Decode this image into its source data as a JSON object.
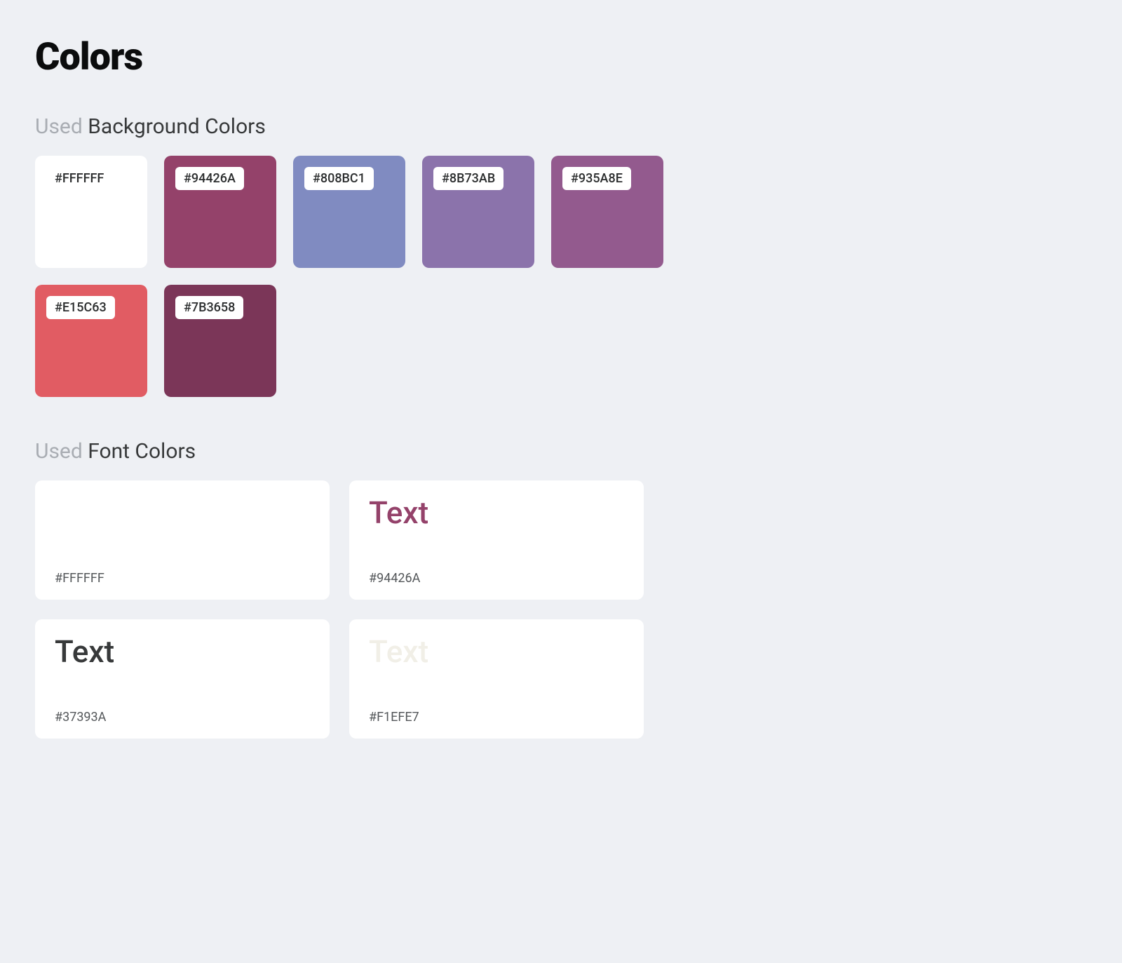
{
  "title": "Colors",
  "sections": {
    "background": {
      "prefix": "Used",
      "label": "Background Colors",
      "swatches": [
        {
          "hex": "#FFFFFF"
        },
        {
          "hex": "#94426A"
        },
        {
          "hex": "#808BC1"
        },
        {
          "hex": "#8B73AB"
        },
        {
          "hex": "#935A8E"
        },
        {
          "hex": "#E15C63"
        },
        {
          "hex": "#7B3658"
        }
      ]
    },
    "font": {
      "prefix": "Used",
      "label": "Font Colors",
      "sample_text": "Text",
      "swatches": [
        {
          "hex": "#FFFFFF"
        },
        {
          "hex": "#94426A"
        },
        {
          "hex": "#37393A"
        },
        {
          "hex": "#F1EFE7"
        }
      ]
    }
  }
}
